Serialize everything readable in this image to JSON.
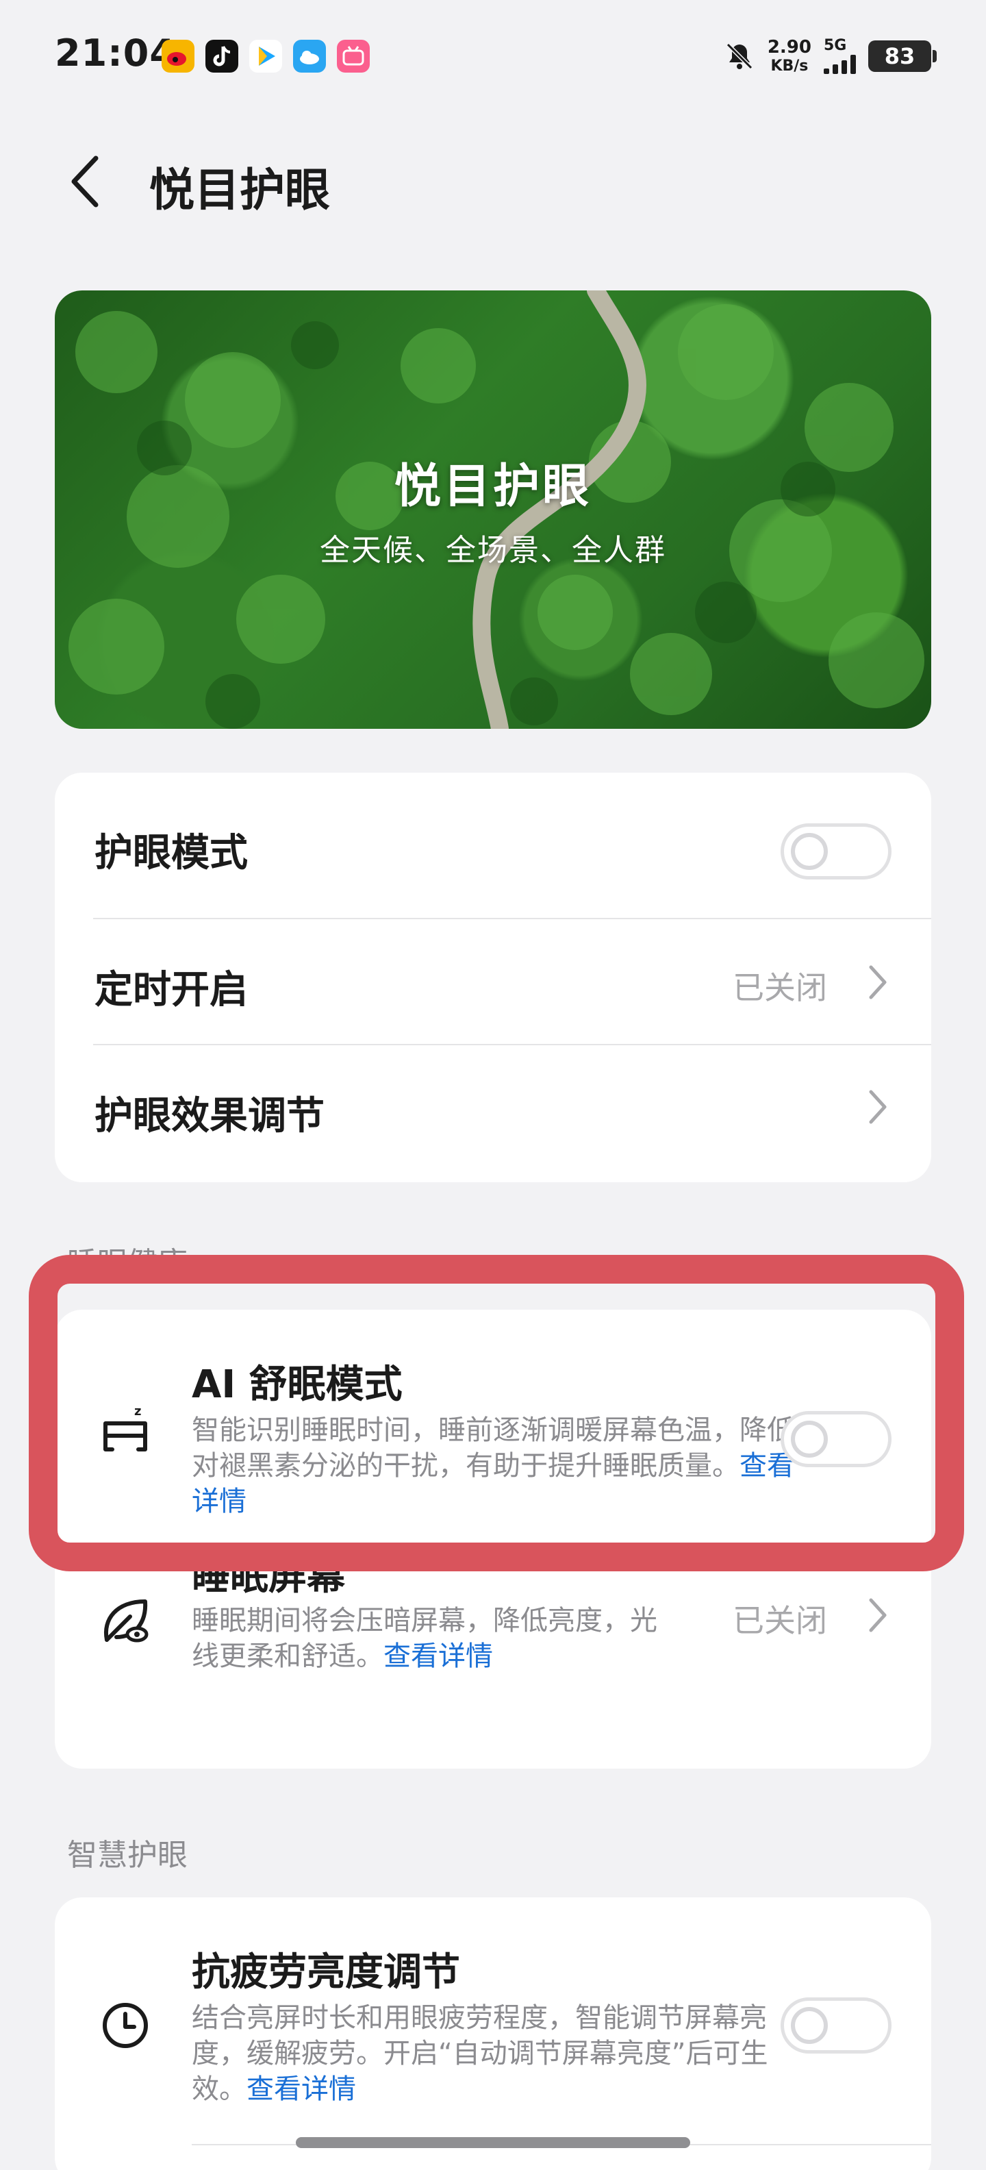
{
  "status_bar": {
    "time": "21:04",
    "apps": [
      {
        "icon": "weibo-icon",
        "color": "#f7b500"
      },
      {
        "icon": "douyin-icon",
        "color": "#111111"
      },
      {
        "icon": "video-player-icon",
        "color": "#1aa8ff"
      },
      {
        "icon": "weather-icon",
        "color": "#2aa6f2"
      },
      {
        "icon": "bilibili-icon",
        "color": "#fb5f8e"
      }
    ],
    "speed_value": "2.90",
    "speed_unit": "KB/s",
    "network": "5G",
    "battery": "83"
  },
  "header": {
    "title": "悦目护眼"
  },
  "banner": {
    "title": "悦目护眼",
    "subtitle": "全天候、全场景、全人群"
  },
  "card1": {
    "eye_mode": {
      "label": "护眼模式",
      "enabled": false
    },
    "schedule": {
      "label": "定时开启",
      "status": "已关闭"
    },
    "effect": {
      "label": "护眼效果调节"
    }
  },
  "sleep_section": {
    "header": "睡眠健康",
    "ai_sleep": {
      "title": "AI 舒眠模式",
      "desc": "智能识别睡眠时间，睡前逐渐调暖屏幕色温，降低对褪黑素分泌的干扰，有助于提升睡眠质量。",
      "link": "查看详情",
      "enabled": false
    },
    "sleep_screen": {
      "title": "睡眠屏幕",
      "desc": "睡眠期间将会压暗屏幕，降低亮度，光线更柔和舒适。",
      "link": "查看详情",
      "status": "已关闭"
    }
  },
  "smart_section": {
    "header": "智慧护眼",
    "anti_fatigue": {
      "title": "抗疲劳亮度调节",
      "desc": "结合亮屏时长和用眼疲劳程度，智能调节屏幕亮度，缓解疲劳。开启“自动调节屏幕亮度”后可生效。",
      "link": "查看详情",
      "enabled": false
    }
  },
  "colors": {
    "accent_link": "#1a6fd6",
    "highlight": "#d9545c"
  }
}
